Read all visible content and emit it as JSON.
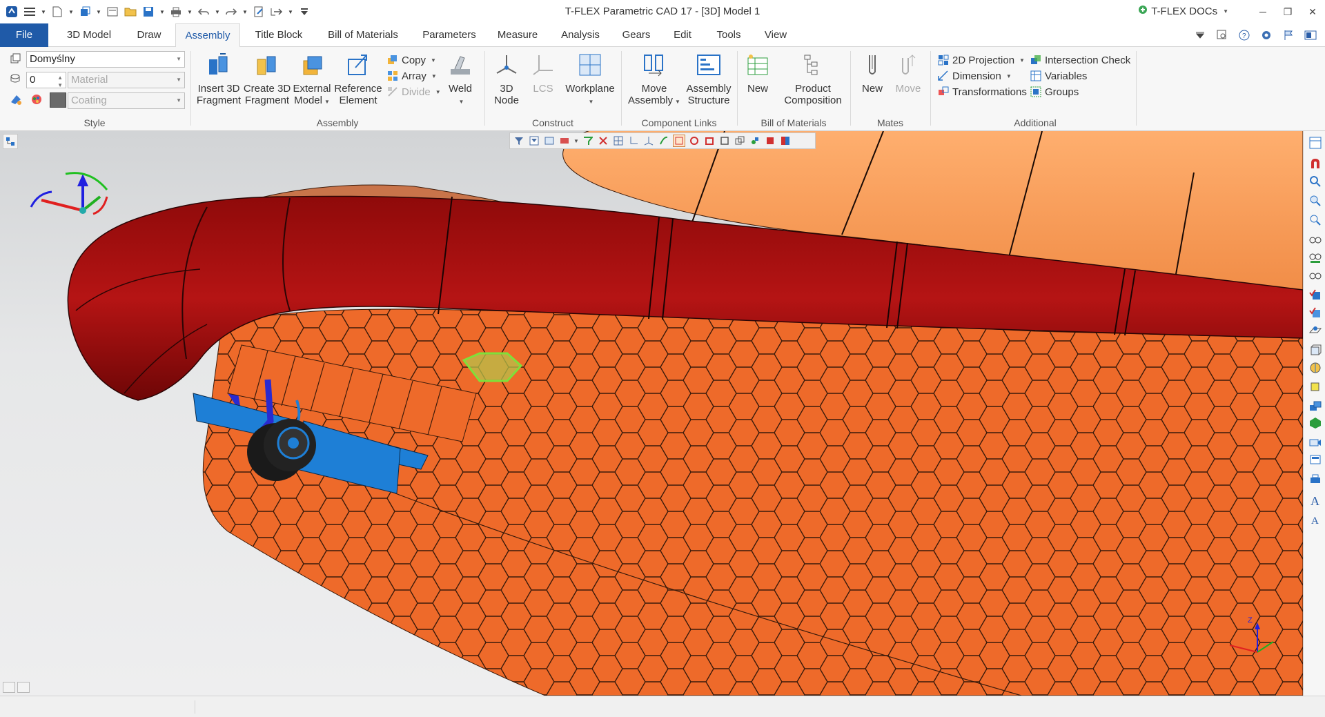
{
  "window": {
    "title": "T-FLEX Parametric CAD 17 - [3D] Model 1",
    "docs_label": "T-FLEX DOCs"
  },
  "menu": {
    "file": "File",
    "tabs": [
      "3D Model",
      "Draw",
      "Assembly",
      "Title Block",
      "Bill of Materials",
      "Parameters",
      "Measure",
      "Analysis",
      "Gears",
      "Edit",
      "Tools",
      "View"
    ],
    "active_tab": "Assembly"
  },
  "style_group": {
    "style_value": "Domyślny",
    "layer_value": "0",
    "material_placeholder": "Material",
    "coating_placeholder": "Coating",
    "label": "Style"
  },
  "assembly_group": {
    "insert_3d_fragment": [
      "Insert 3D",
      "Fragment"
    ],
    "create_3d_fragment": [
      "Create 3D",
      "Fragment"
    ],
    "external_model": [
      "External",
      "Model"
    ],
    "reference_element": [
      "Reference",
      "Element"
    ],
    "copy": "Copy",
    "array": "Array",
    "divide": "Divide",
    "weld": "Weld",
    "label": "Assembly"
  },
  "construct_group": {
    "node": [
      "3D",
      "Node"
    ],
    "lcs": "LCS",
    "workplane": "Workplane",
    "label": "Construct"
  },
  "component_links_group": {
    "move_assembly": [
      "Move",
      "Assembly"
    ],
    "assembly_structure": [
      "Assembly",
      "Structure"
    ],
    "label": "Component Links"
  },
  "bom_group": {
    "new": "New",
    "product_composition": [
      "Product",
      "Composition"
    ],
    "label": "Bill of Materials"
  },
  "mates_group": {
    "new": "New",
    "move": "Move",
    "label": "Mates"
  },
  "additional_group": {
    "projection_2d": "2D Projection",
    "dimension": "Dimension",
    "transformations": "Transformations",
    "intersection_check": "Intersection Check",
    "variables": "Variables",
    "groups": "Groups",
    "label": "Additional"
  },
  "colors": {
    "accent": "#1f5aa8",
    "hull_red": "#a50e0e",
    "tile_orange": "#ee6a2a",
    "tank_orange": "#ffa05a",
    "gear_blue": "#1e7fd6",
    "selection_green": "#7fe03a"
  },
  "icons": {
    "axis_triad": "axis-triad-icon",
    "view_axis": "view-axis-icon"
  }
}
